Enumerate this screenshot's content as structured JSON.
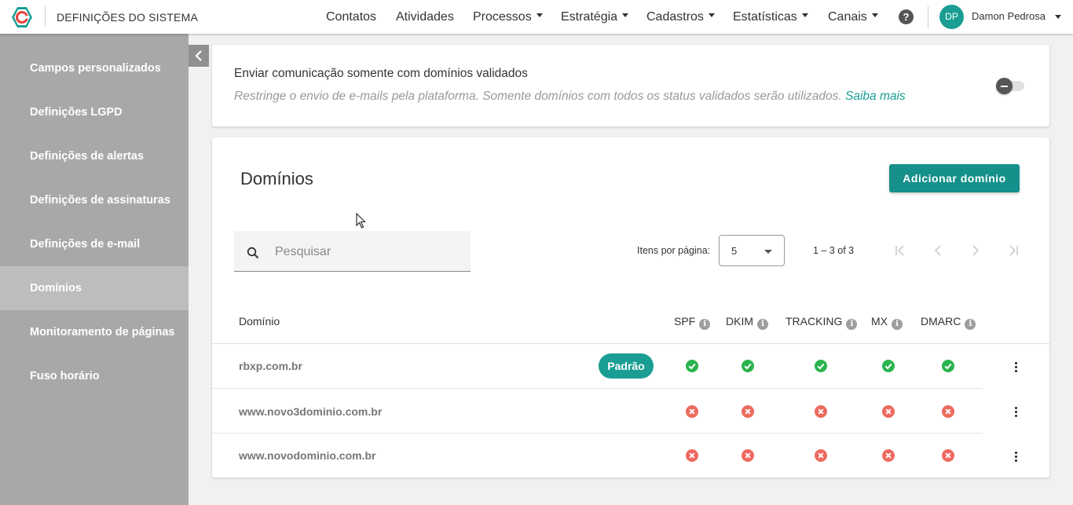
{
  "header": {
    "app_title": "DEFINIÇÕES DO SISTEMA",
    "nav": [
      {
        "label": "Contatos",
        "has_caret": false
      },
      {
        "label": "Atividades",
        "has_caret": false
      },
      {
        "label": "Processos",
        "has_caret": true
      },
      {
        "label": "Estratégia",
        "has_caret": true
      },
      {
        "label": "Cadastros",
        "has_caret": true
      },
      {
        "label": "Estatísticas",
        "has_caret": true
      },
      {
        "label": "Canais",
        "has_caret": true
      }
    ],
    "help_label": "?",
    "user": {
      "initials": "DP",
      "name": "Damon Pedrosa"
    }
  },
  "sidebar": {
    "items": [
      {
        "label": "Campos personalizados"
      },
      {
        "label": "Definições LGPD"
      },
      {
        "label": "Definições de alertas"
      },
      {
        "label": "Definições de assinaturas"
      },
      {
        "label": "Definições de e-mail"
      },
      {
        "label": "Domínios",
        "active": true
      },
      {
        "label": "Monitoramento de páginas"
      },
      {
        "label": "Fuso horário"
      }
    ]
  },
  "validated_setting": {
    "title": "Enviar comunicação somente com domínios validados",
    "description": "Restringe o envio de e-mails pela plataforma. Somente domínios com todos os status validados serão utilizados.",
    "link_label": "Saiba mais",
    "enabled": false
  },
  "domains": {
    "title": "Domínios",
    "add_button": "Adicionar domínio",
    "search_placeholder": "Pesquisar",
    "items_per_page_label": "Itens por página:",
    "items_per_page_value": "5",
    "range_label": "1 – 3 of 3",
    "columns": {
      "domain": "Domínio",
      "spf": "SPF",
      "dkim": "DKIM",
      "tracking": "TRACKING",
      "mx": "MX",
      "dmarc": "DMARC"
    },
    "default_badge": "Padrão",
    "rows": [
      {
        "domain": "rbxp.com.br",
        "is_default": true,
        "spf": "ok",
        "dkim": "ok",
        "tracking": "ok",
        "mx": "ok",
        "dmarc": "ok"
      },
      {
        "domain": "www.novo3dominio.com.br",
        "is_default": false,
        "spf": "error",
        "dkim": "error",
        "tracking": "error",
        "mx": "error",
        "dmarc": "error"
      },
      {
        "domain": "www.novodominio.com.br",
        "is_default": false,
        "spf": "error",
        "dkim": "error",
        "tracking": "error",
        "mx": "error",
        "dmarc": "error"
      }
    ]
  }
}
